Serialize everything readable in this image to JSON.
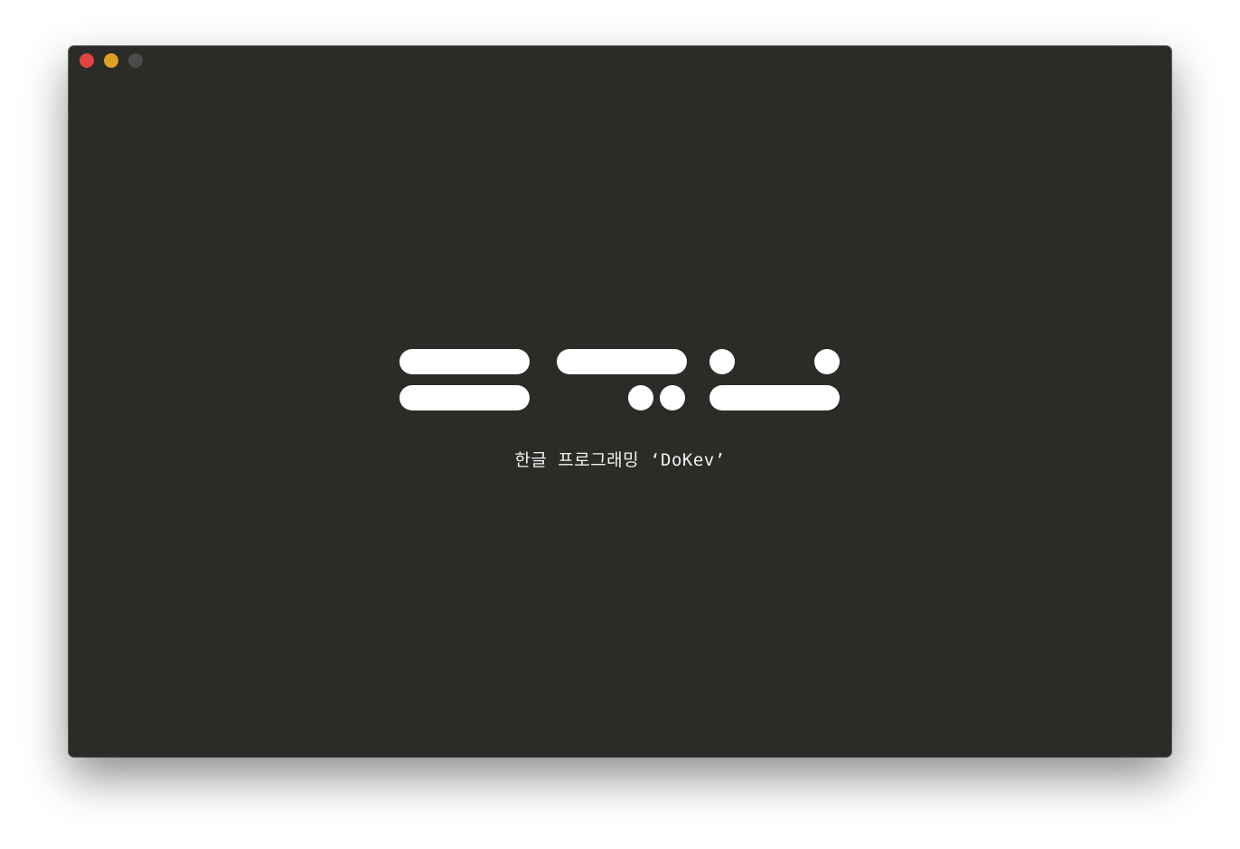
{
  "window": {
    "background": "#2b2b28",
    "controls": [
      {
        "name": "close-button",
        "color": "#e0443e"
      },
      {
        "name": "minimize-button",
        "color": "#dea123"
      },
      {
        "name": "zoom-button",
        "color": "#4b4b4b"
      }
    ]
  },
  "logo": {
    "icon": "dokev-morse-logo",
    "color": "#ffffff"
  },
  "subtitle": "한글 프로그래밍 ‘DoKev’"
}
